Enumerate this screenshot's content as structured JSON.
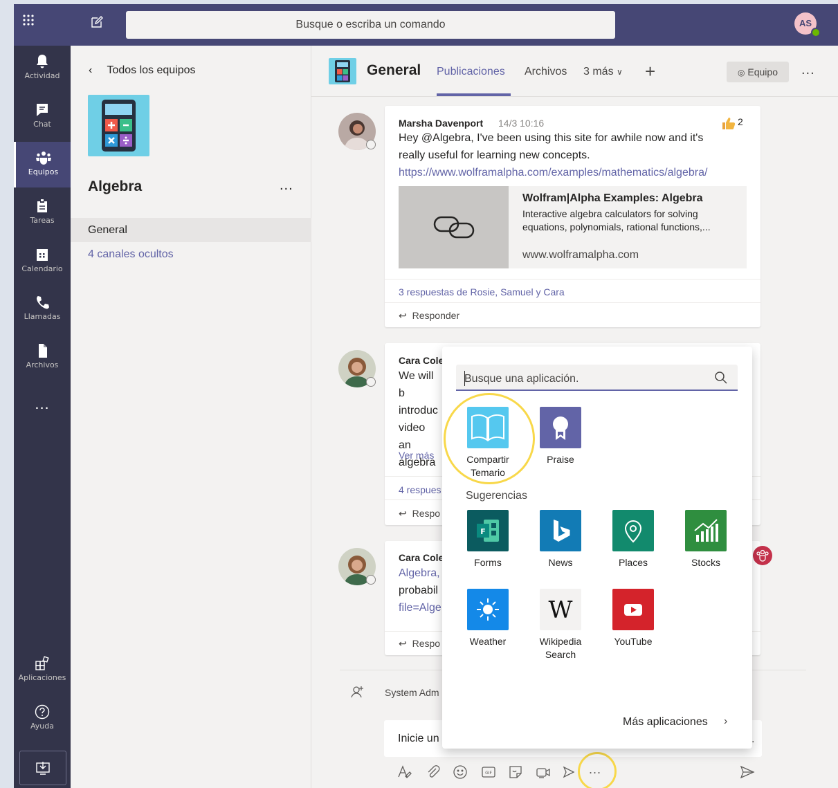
{
  "topbar": {
    "search_placeholder": "Busque o escriba un comando",
    "avatar_initials": "AS"
  },
  "rail": {
    "items": [
      {
        "label": "Actividad"
      },
      {
        "label": "Chat"
      },
      {
        "label": "Equipos"
      },
      {
        "label": "Tareas"
      },
      {
        "label": "Calendario"
      },
      {
        "label": "Llamadas"
      },
      {
        "label": "Archivos"
      }
    ],
    "more": "...",
    "apps_label": "Aplicaciones",
    "help_label": "Ayuda"
  },
  "team": {
    "back_label": "Todos los equipos",
    "name": "Algebra",
    "more": "...",
    "channels": [
      "General"
    ],
    "hidden_channels": "4 canales ocultos"
  },
  "channel": {
    "title": "General",
    "tabs": [
      "Publicaciones",
      "Archivos",
      "3 más"
    ],
    "add_tab": "+",
    "team_button": "Equipo",
    "more": "..."
  },
  "messages": [
    {
      "sender": "Marsha Davenport",
      "time": "14/3 10:16",
      "text": "Hey @Algebra, I've been using this site for awhile now and it's really useful for learning new concepts.",
      "line1": "Hey @Algebra, I've been using this site for awhile now and it's",
      "line2": "really useful for learning new concepts.",
      "link": "https://www.wolframalpha.com/examples/mathematics/algebra/",
      "reactions": 2,
      "reaction_label": "2",
      "preview": {
        "title": "Wolfram|Alpha Examples: Algebra",
        "description": "Interactive algebra calculators for solving equations, polynomials, rational functions,...",
        "domain": "www.wolframalpha.com"
      },
      "replies": "3 respuestas de Rosie, Samuel y Cara",
      "reply_label": "Responder"
    },
    {
      "sender": "Cara Cole",
      "lines": [
        "We will b",
        "introduc",
        "video an",
        "algebra"
      ],
      "see_more": "Ver más",
      "replies": "4 respues",
      "reply_label": "Respo"
    },
    {
      "sender": "Cara Cole",
      "lines": [
        "Algebra,",
        "probabil",
        "file=Alge"
      ],
      "reply_label": "Respo"
    }
  ],
  "composer": {
    "system_text": "System Adm",
    "placeholder": "Inicie un",
    "tools_more": "..."
  },
  "picker": {
    "search_placeholder": "Busque una aplicación.",
    "pinned": [
      {
        "name": "Compartir Temario",
        "line1": "Compartir",
        "line2": "Temario",
        "icon": "book-icon",
        "color": "#55c8ef"
      },
      {
        "name": "Praise",
        "icon": "ribbon-icon",
        "color": "#6264a7"
      }
    ],
    "suggestions_label": "Sugerencias",
    "suggestions": [
      {
        "name": "Forms",
        "icon": "forms-icon",
        "color": "#0b5b5f"
      },
      {
        "name": "News",
        "icon": "bing-icon",
        "color": "#127bb5"
      },
      {
        "name": "Places",
        "icon": "pin-icon",
        "color": "#128a6d"
      },
      {
        "name": "Stocks",
        "icon": "chart-icon",
        "color": "#2f8e3f"
      },
      {
        "name": "Weather",
        "icon": "sun-icon",
        "color": "#1489e8"
      },
      {
        "name": "Wikipedia Search",
        "line1": "Wikipedia",
        "line2": "Search",
        "icon": "wikipedia-icon",
        "color": "#f3f2f1"
      },
      {
        "name": "YouTube",
        "icon": "youtube-icon",
        "color": "#d4232b"
      }
    ],
    "more_apps": "Más aplicaciones"
  }
}
